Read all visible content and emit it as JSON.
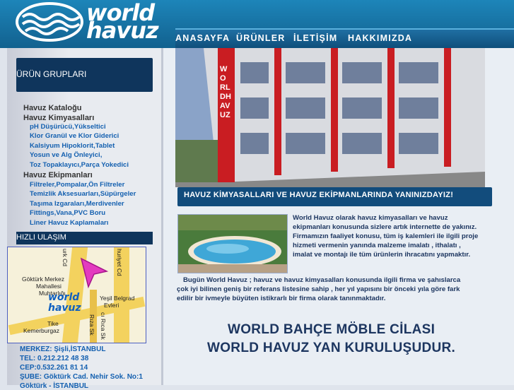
{
  "logo": {
    "line1": "world",
    "line2": "havuz"
  },
  "nav": {
    "items": [
      "ANASAYFA",
      "ÜRÜNLER",
      "İLETİŞİM",
      "HAKKIMIZDA"
    ]
  },
  "sidebar": {
    "groups_title": "ÜRÜN GRUPLARI",
    "menu": [
      {
        "label": "Havuz Kataloğu",
        "sub": []
      },
      {
        "label": "Havuz Kimyasalları",
        "sub": [
          "pH Düşürücü,Yükseltici",
          "Klor Granül ve Klor Giderici",
          "Kalsiyum Hipoklorit,Tablet",
          "Yosun ve Alg Önleyici,",
          "Toz Topaklayıcı,Parça Yokedici"
        ]
      },
      {
        "label": "Havuz Ekipmanları",
        "sub": [
          "Filtreler,Pompalar,Ön Filtreler",
          "Temizlik Aksesuarları,Süpürgeler",
          "Taşıma Izgaraları,Merdivenler",
          "Fittings,Vana,PVC Boru",
          "Liner Havuz Kaplamaları"
        ]
      }
    ],
    "quick_title": "HIZLI ULAŞIM",
    "map": {
      "labels": [
        "Göktürk Merkez",
        "Mahallesi",
        "Muhtarlığı",
        "Yeşil Belgrad",
        "Evleri",
        "Tike",
        "Kemerburgaz",
        "urk Cd",
        "huriyet Cd",
        "Rıza Sk",
        "cı Rıca Sk"
      ],
      "logo_line1": "world",
      "logo_line2": "havuz"
    },
    "contact": [
      "MERKEZ: Şişli,İSTANBUL",
      "TEL: 0.212.212 48 38",
      "CEP:0.532.261 81 14",
      "ŞUBE:  Göktürk Cad. Nehir Sok. No:1",
      "Göktürk - İSTANBUL"
    ]
  },
  "main": {
    "photo_sign": "WORLDHAVUZ",
    "banner": "HAVUZ KİMYASALLARI VE HAVUZ EKİPMANLARINDA YANINIZDAYIZ!",
    "intro": "World Havuz olarak havuz kimyasalları ve havuz ekipmanları konusunda sizlere artık internette de yakınız. Firmamızın faaliyet konusu, tüm iş kalemleri ile ilgili proje hizmeti vermenin yanında malzeme imalatı , ithalatı , imalat ve montajı ile tüm ürünlerin ihracatını yapmaktır.",
    "intro_lines": [
      "World Havuz olarak havuz kimyasalları ve havuz",
      "ekipmanları konusunda sizlere artık internette de yakınız.",
      "Firmamızın faaliyet konusu, tüm iş kalemleri ile ilgili proje",
      "hizmeti vermenin yanında malzeme imalatı , ithalatı ,",
      "imalat ve montajı ile tüm ürünlerin ihracatını yapmaktır."
    ],
    "today_lines": [
      "Bugün World Havuz ; havuz  ve havuz kimyasalları  konusunda ilgili firma ve şahıslarca",
      "çok iyi bilinen geniş bir referans listesine sahip , her yıl yapısını bir önceki yıla göre fark",
      "edilir bir ivmeyle büyüten istikrarlı bir firma olarak tanınmaktadır."
    ],
    "big_lines": [
      "WORLD BAHÇE MÖBLE CİLASI",
      "WORLD HAVUZ YAN KURULUŞUDUR."
    ]
  }
}
